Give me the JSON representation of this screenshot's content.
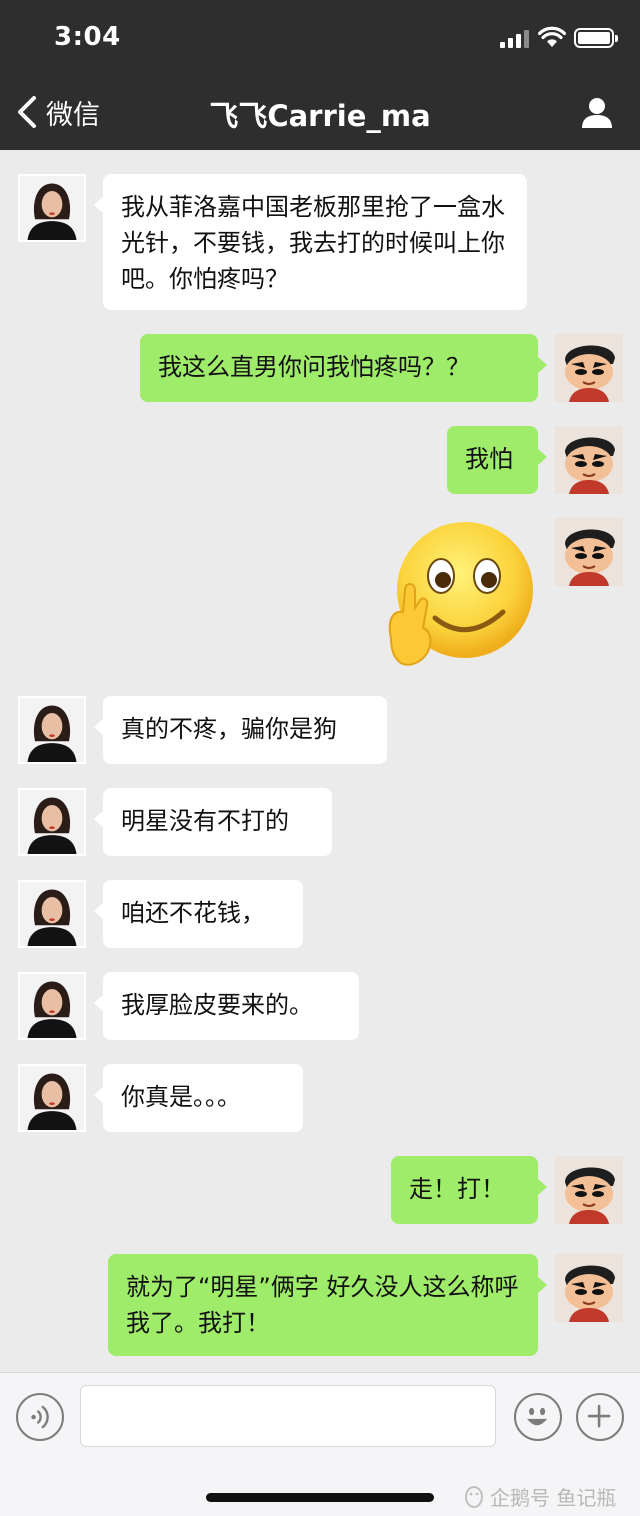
{
  "status_bar": {
    "time": "3:04"
  },
  "nav": {
    "back_label": "微信",
    "title": "飞飞Carrie_ma"
  },
  "messages": [
    {
      "side": "left",
      "text": "我从菲洛嘉中国老板那里抢了一盒水光针，不要钱，我去打的时候叫上你吧。你怕疼吗？"
    },
    {
      "side": "right",
      "text": "我这么直男你问我怕疼吗？？"
    },
    {
      "side": "right",
      "text": "我怕"
    },
    {
      "side": "right",
      "sticker": "smile-hand-emoji"
    },
    {
      "side": "left",
      "text": "真的不疼，骗你是狗"
    },
    {
      "side": "left",
      "text": "明星没有不打的"
    },
    {
      "side": "left",
      "text": "咱还不花钱，"
    },
    {
      "side": "left",
      "text": "我厚脸皮要来的。"
    },
    {
      "side": "left",
      "text": "你真是。。。"
    },
    {
      "side": "right",
      "text": "走！打！"
    },
    {
      "side": "right",
      "text": "就为了“明星”俩字 好久没人这么称呼我了。我打！"
    }
  ],
  "input_bar": {
    "text_value": ""
  },
  "watermark": "企鹅号 鱼记瓶",
  "colors": {
    "header": "#2e2e2e",
    "chat_bg": "#ebebeb",
    "sent_bubble": "#9feb6a",
    "received_bubble": "#ffffff"
  },
  "icons": [
    "back-chevron-icon",
    "profile-icon",
    "voice-icon",
    "emoji-icon",
    "plus-icon",
    "signal-icon",
    "wifi-icon",
    "battery-icon"
  ]
}
